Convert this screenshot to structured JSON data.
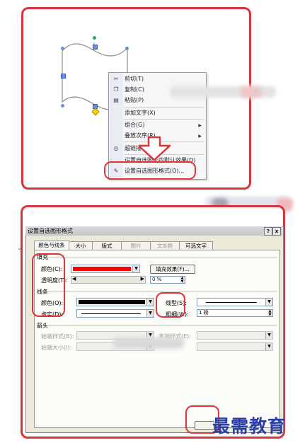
{
  "context_menu": {
    "items": [
      {
        "label": "剪切(T)",
        "icon": "scissors-icon"
      },
      {
        "label": "复制(C)",
        "icon": "copy-icon"
      },
      {
        "label": "粘贴(P)",
        "icon": "paste-icon"
      },
      {
        "label": "添加文字(X)",
        "icon": ""
      },
      {
        "label": "组合(G)",
        "icon": "",
        "submenu": true
      },
      {
        "label": "叠放次序(R)",
        "icon": "",
        "submenu": true
      },
      {
        "label": "超链接(H)...",
        "icon": "hyperlink-icon"
      },
      {
        "label": "设置自选图形的默认效果(D)",
        "icon": ""
      },
      {
        "label": "设置自选图形格式(O)...",
        "icon": "format-shape-icon"
      }
    ]
  },
  "dialog": {
    "title": "设置自选图形格式",
    "help_button": "?",
    "close_button": "x",
    "tabs": [
      "颜色与线条",
      "大小",
      "版式",
      "图片",
      "文本框",
      "可选文字"
    ],
    "fill": {
      "group_label": "填充",
      "color_label": "颜色(C):",
      "color_value": "#ff0000",
      "fill_effects_button": "填充效果(F)...",
      "transparency_label": "透明度(T):",
      "transparency_value": "0 %"
    },
    "line": {
      "group_label": "线条",
      "color_label": "颜色(O):",
      "color_value": "#000000",
      "dash_label": "虚实(D):",
      "style_label": "线型(S):",
      "weight_label": "粗细(W):",
      "weight_value": "1 磅"
    },
    "arrows": {
      "group_label": "箭头",
      "begin_style_label": "始端样式(B):",
      "begin_size_label": "始端大小(I):",
      "end_style_label": "末端样式(E):"
    }
  },
  "watermark": "最需教育",
  "colors": {
    "highlight": "#e0333b",
    "selection_handle": "#6b8cd6",
    "rotate_handle": "#2fae4e",
    "adjust_handle": "#f4d200"
  }
}
